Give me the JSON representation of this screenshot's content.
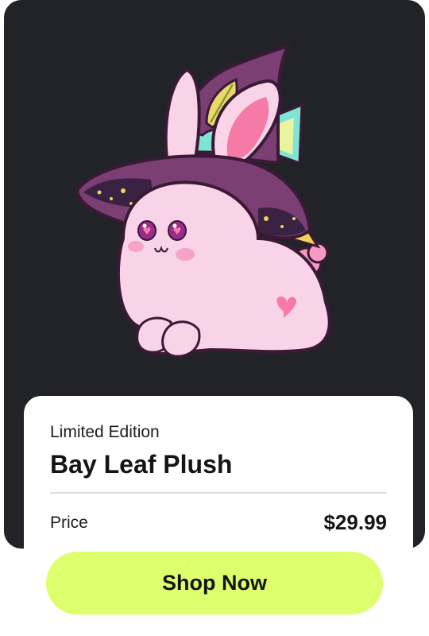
{
  "product": {
    "image_name": "witch-hat-bunny-illustration",
    "subtitle": "Limited Edition",
    "title": "Bay Leaf Plush",
    "price_label": "Price",
    "price_value": "$29.99"
  },
  "cta": {
    "label": "Shop Now"
  },
  "colors": {
    "card_bg": "#222326",
    "button_bg": "#ddff6e",
    "hat": "#7b3f73",
    "bunny": "#f9d3e8",
    "accent_mint": "#7fe4d4"
  }
}
